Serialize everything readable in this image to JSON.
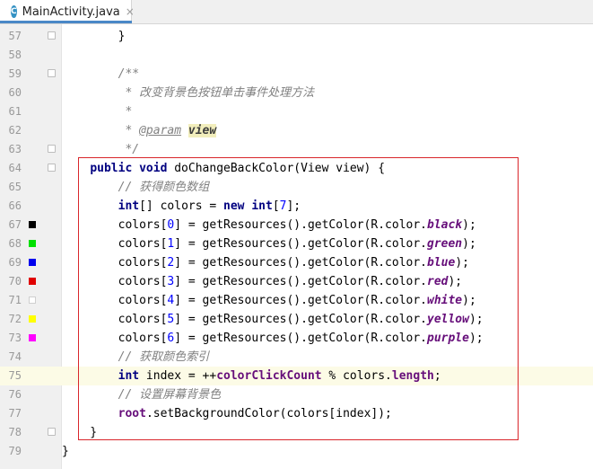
{
  "tab": {
    "icon_letter": "C",
    "title": "MainActivity.java",
    "close": "×"
  },
  "current_line": 75,
  "colors": {
    "swatch_border": "#cfcfcf",
    "highlight": "#d9262b",
    "current_line": "#fcfbe6"
  },
  "lines": [
    {
      "num": "57",
      "fold": true,
      "swatch": null,
      "code": [
        {
          "t": "        }"
        }
      ]
    },
    {
      "num": "58",
      "fold": false,
      "swatch": null,
      "code": []
    },
    {
      "num": "59",
      "fold": true,
      "swatch": null,
      "code": [
        {
          "t": "        "
        },
        {
          "c": "cm",
          "t": "/**"
        }
      ]
    },
    {
      "num": "60",
      "fold": false,
      "swatch": null,
      "code": [
        {
          "t": "        "
        },
        {
          "c": "cm",
          "t": " * 改变背景色按钮单击事件处理方法"
        }
      ]
    },
    {
      "num": "61",
      "fold": false,
      "swatch": null,
      "code": [
        {
          "t": "        "
        },
        {
          "c": "cm",
          "t": " *"
        }
      ]
    },
    {
      "num": "62",
      "fold": false,
      "swatch": null,
      "code": [
        {
          "t": "        "
        },
        {
          "c": "cm",
          "t": " * "
        },
        {
          "c": "doctag",
          "t": "@param"
        },
        {
          "c": "cm",
          "t": " "
        },
        {
          "c": "docparam",
          "t": "view"
        }
      ]
    },
    {
      "num": "63",
      "fold": true,
      "swatch": null,
      "code": [
        {
          "t": "        "
        },
        {
          "c": "cm",
          "t": " */"
        }
      ]
    },
    {
      "num": "64",
      "fold": true,
      "swatch": null,
      "code": [
        {
          "t": "    "
        },
        {
          "c": "kw",
          "t": "public void "
        },
        {
          "t": "doChangeBackColor(View view) {"
        }
      ]
    },
    {
      "num": "65",
      "fold": false,
      "swatch": null,
      "code": [
        {
          "t": "        "
        },
        {
          "c": "cm",
          "t": "// 获得颜色数组"
        }
      ]
    },
    {
      "num": "66",
      "fold": false,
      "swatch": null,
      "code": [
        {
          "t": "        "
        },
        {
          "c": "kw",
          "t": "int"
        },
        {
          "t": "[] colors = "
        },
        {
          "c": "kw",
          "t": "new int"
        },
        {
          "t": "["
        },
        {
          "c": "num",
          "t": "7"
        },
        {
          "t": "];"
        }
      ]
    },
    {
      "num": "67",
      "fold": false,
      "swatch": "#000000",
      "code": [
        {
          "t": "        colors["
        },
        {
          "c": "num",
          "t": "0"
        },
        {
          "t": "] = getResources().getColor(R.color."
        },
        {
          "c": "sfld",
          "t": "black"
        },
        {
          "t": ");"
        }
      ]
    },
    {
      "num": "68",
      "fold": false,
      "swatch": "#00e000",
      "code": [
        {
          "t": "        colors["
        },
        {
          "c": "num",
          "t": "1"
        },
        {
          "t": "] = getResources().getColor(R.color."
        },
        {
          "c": "sfld",
          "t": "green"
        },
        {
          "t": ");"
        }
      ]
    },
    {
      "num": "69",
      "fold": false,
      "swatch": "#0000ee",
      "code": [
        {
          "t": "        colors["
        },
        {
          "c": "num",
          "t": "2"
        },
        {
          "t": "] = getResources().getColor(R.color."
        },
        {
          "c": "sfld",
          "t": "blue"
        },
        {
          "t": ");"
        }
      ]
    },
    {
      "num": "70",
      "fold": false,
      "swatch": "#e00000",
      "code": [
        {
          "t": "        colors["
        },
        {
          "c": "num",
          "t": "3"
        },
        {
          "t": "] = getResources().getColor(R.color."
        },
        {
          "c": "sfld",
          "t": "red"
        },
        {
          "t": ");"
        }
      ]
    },
    {
      "num": "71",
      "fold": false,
      "swatch": "#ffffff",
      "code": [
        {
          "t": "        colors["
        },
        {
          "c": "num",
          "t": "4"
        },
        {
          "t": "] = getResources().getColor(R.color."
        },
        {
          "c": "sfld",
          "t": "white"
        },
        {
          "t": ");"
        }
      ]
    },
    {
      "num": "72",
      "fold": false,
      "swatch": "#ffff00",
      "code": [
        {
          "t": "        colors["
        },
        {
          "c": "num",
          "t": "5"
        },
        {
          "t": "] = getResources().getColor(R.color."
        },
        {
          "c": "sfld",
          "t": "yellow"
        },
        {
          "t": ");"
        }
      ]
    },
    {
      "num": "73",
      "fold": false,
      "swatch": "#ff00ff",
      "code": [
        {
          "t": "        colors["
        },
        {
          "c": "num",
          "t": "6"
        },
        {
          "t": "] = getResources().getColor(R.color."
        },
        {
          "c": "sfld",
          "t": "purple"
        },
        {
          "t": ");"
        }
      ]
    },
    {
      "num": "74",
      "fold": false,
      "swatch": null,
      "code": [
        {
          "t": "        "
        },
        {
          "c": "cm",
          "t": "// 获取颜色索引"
        }
      ]
    },
    {
      "num": "75",
      "fold": false,
      "swatch": null,
      "code": [
        {
          "t": "        "
        },
        {
          "c": "kw",
          "t": "int"
        },
        {
          "t": " index = ++"
        },
        {
          "c": "fld",
          "t": "colorClickCount"
        },
        {
          "t": " % colors."
        },
        {
          "c": "fld",
          "t": "length"
        },
        {
          "t": ";"
        }
      ]
    },
    {
      "num": "76",
      "fold": false,
      "swatch": null,
      "code": [
        {
          "t": "        "
        },
        {
          "c": "cm",
          "t": "// 设置屏幕背景色"
        }
      ]
    },
    {
      "num": "77",
      "fold": false,
      "swatch": null,
      "code": [
        {
          "t": "        "
        },
        {
          "c": "fld",
          "t": "root"
        },
        {
          "t": ".setBackgroundColor(colors[index]);"
        }
      ]
    },
    {
      "num": "78",
      "fold": true,
      "swatch": null,
      "code": [
        {
          "t": "    }"
        }
      ]
    },
    {
      "num": "79",
      "fold": false,
      "swatch": null,
      "code": [
        {
          "t": "}"
        }
      ]
    }
  ]
}
